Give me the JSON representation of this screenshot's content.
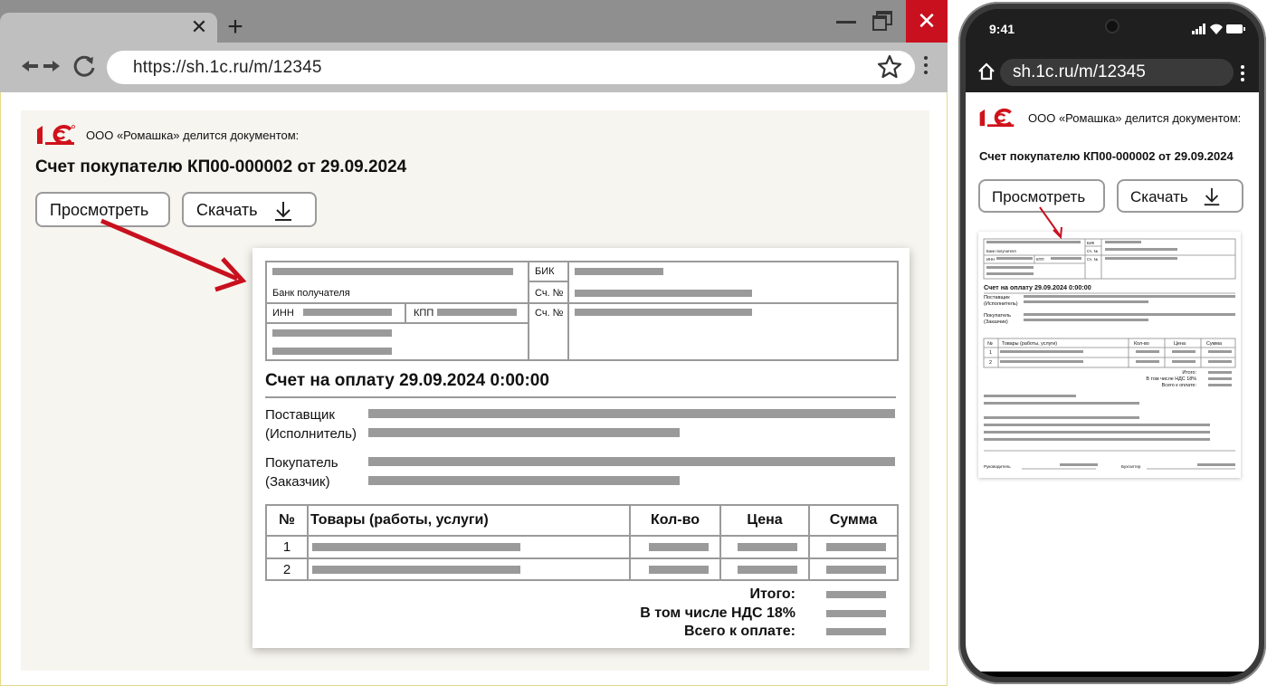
{
  "browser": {
    "tab_close_glyph": "✕",
    "new_tab_glyph": "+",
    "close_window_glyph": "✕",
    "url": "https://sh.1c.ru/m/12345",
    "icons": [
      "back-icon",
      "forward-icon",
      "reload-icon",
      "star-icon",
      "menu-icon"
    ]
  },
  "share": {
    "logo": "1С",
    "text": "ООО «Ромашка» делится документом:",
    "title": "Счет покупателю КП00-000002 от 29.09.2024",
    "view_label": "Просмотреть",
    "download_label": "Скачать"
  },
  "invoice": {
    "bank_label": "Банк получателя",
    "bik": "БИК",
    "account1": "Сч. №",
    "inn": "ИНН",
    "kpp": "КПП",
    "account2": "Сч. №",
    "heading": "Счет на оплату 29.09.2024 0:00:00",
    "supplier_l1": "Поставщик",
    "supplier_l2": "(Исполнитель)",
    "buyer_l1": "Покупатель",
    "buyer_l2": "(Заказчик)",
    "columns": [
      "№",
      "Товары (работы, услуги)",
      "Кол-во",
      "Цена",
      "Сумма"
    ],
    "rows": [
      "1",
      "2"
    ],
    "total": "Итого:",
    "vat": "В том числе НДС 18%",
    "grand_total": "Всего к оплате:"
  },
  "phone": {
    "time": "9:41",
    "url": "sh.1c.ru/m/12345",
    "signature_head": "Руководитель",
    "signature_accountant": "Бухгалтер",
    "mini_bank_label": "Банк получателя",
    "mini_bik": "БИК",
    "mini_account": "Сч. №",
    "mini_inn": "ИНН",
    "mini_kpp": "КПП",
    "mini_heading": "Счет на оплату 29.09.2024 0:00:00"
  },
  "colors": {
    "accent_red": "#d0121b",
    "close_red": "#c8101e",
    "placeholder_gray": "#9a9a9a"
  }
}
